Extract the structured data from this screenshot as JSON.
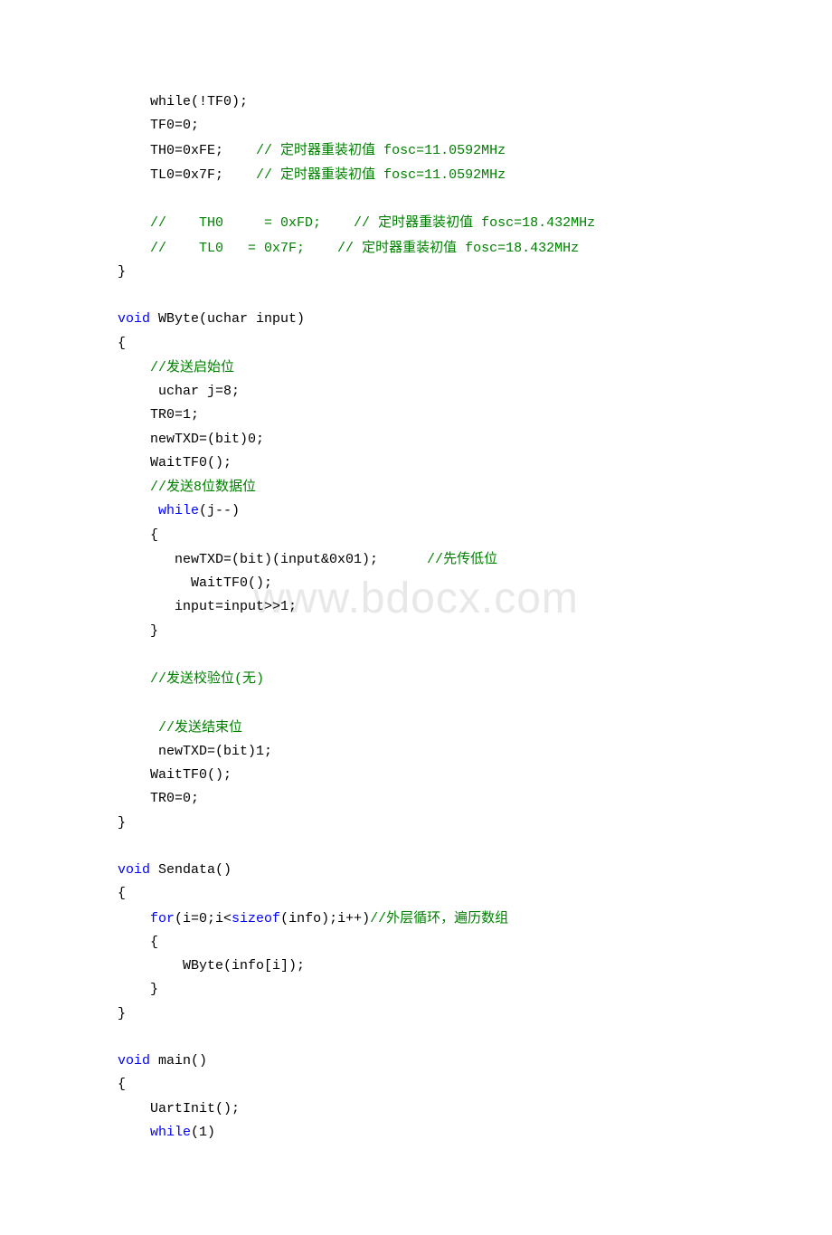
{
  "watermark": "www.bdocx.com",
  "code": {
    "l1": "    while(!TF0);",
    "l2": "    TF0=0;",
    "l3a": "    TH0=0xFE;",
    "l3b": "    // ",
    "l3c": "定时器重装初值",
    "l3d": " fosc=11.0592MHz",
    "l4a": "    TL0=0x7F;",
    "l4b": "    // ",
    "l4c": "定时器重装初值",
    "l4d": " fosc=11.0592MHz",
    "l5a": "    //    TH0     = 0xFD;",
    "l5b": "    // ",
    "l5c": "定时器重装初值",
    "l5d": " fosc=18.432MHz",
    "l6a": "    //    TL0   = 0x7F;",
    "l6b": "    // ",
    "l6c": "定时器重装初值",
    "l6d": " fosc=18.432MHz",
    "l7": "}",
    "l8": "void WByte(uchar input)",
    "l8_void": "void",
    "l8_rest": " WByte(uchar input)",
    "l9": "{",
    "l10a": "    //",
    "l10b": "发送启始位",
    "l11": "     uchar j=8;",
    "l12": "    TR0=1;",
    "l13": "    newTXD=(bit)0;",
    "l14": "    WaitTF0();",
    "l15a": "    //",
    "l15b": "发送",
    "l15c": "8",
    "l15d": "位数据位",
    "l16": "     while(j--)",
    "l16_kw": "while",
    "l16_pre": "     ",
    "l16_post": "(j--)",
    "l17": "    {",
    "l18a": "       newTXD=(bit)(input&0x01);",
    "l18b": "      //",
    "l18c": "先传低位",
    "l19": "         WaitTF0();",
    "l20": "       input=input>>1;",
    "l21": "    }",
    "l22a": "    //",
    "l22b": "发送校验位",
    "l22c": "(",
    "l22d": "无",
    "l22e": ")",
    "l23a": "     //",
    "l23b": "发送结束位",
    "l24": "     newTXD=(bit)1;",
    "l25": "    WaitTF0();",
    "l26": "    TR0=0;",
    "l27": "}",
    "l28_void": "void",
    "l28_rest": " Sendata()",
    "l29": "{",
    "l30a": "    ",
    "l30_kw": "for",
    "l30b": "(i=0;i<",
    "l30_kw2": "sizeof",
    "l30c": "(info);i++)",
    "l30d": "//",
    "l30e": "外层循环，遍历数组",
    "l31": "    {",
    "l32": "        WByte(info[i]);",
    "l33": "    }",
    "l34": "}",
    "l35_void": "void",
    "l35_rest": " main()",
    "l36": "{",
    "l37": "    UartInit();",
    "l38a": "    ",
    "l38_kw": "while",
    "l38b": "(1)"
  }
}
